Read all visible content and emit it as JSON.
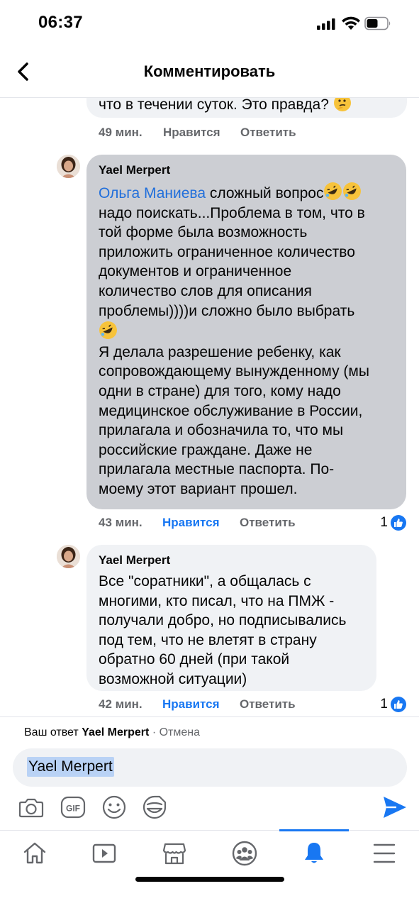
{
  "status_bar": {
    "time": "06:37"
  },
  "header": {
    "title": "Комментировать"
  },
  "previous_comment": {
    "text_tail": "что в течении суток. Это правда?",
    "time": "49 мин.",
    "like_label": "Нравится",
    "reply_label": "Ответить"
  },
  "comments": [
    {
      "author": "Yael Merpert",
      "mention": "Ольга Маниева",
      "lines": [
        "сложный вопрос",
        "надо поискать...Проблема в том, что в",
        "той форме была возможность",
        "приложить ограниченное количество",
        "документов и ограниченное",
        "количество слов для описания",
        "проблемы))))и сложно было выбрать",
        "Я делала разрешение ребенку, как",
        "сопровождающему вынужденному (мы",
        "одни в стране) для того, кому надо",
        "медицинское обслуживание в России,",
        "прилагала и обозначила то, что мы",
        "российские граждане. Даже не",
        "прилагала местные паспорта. По-",
        "моему этот вариант прошел."
      ],
      "time": "43 мин.",
      "like_label": "Нравится",
      "reply_label": "Ответить",
      "like_count": "1"
    },
    {
      "author": "Yael Merpert",
      "lines": [
        "Все \"соратники\", а общалась с",
        "многими, кто писал, что на ПМЖ -",
        "получали добро, но подписывались",
        "под тем, что не влетят в страну",
        "обратно 60 дней (при такой",
        "возможной ситуации)"
      ],
      "time": "42 мин.",
      "like_label": "Нравится",
      "reply_label": "Ответить",
      "like_count": "1"
    }
  ],
  "reply_bar": {
    "prefix": "Ваш ответ",
    "target": "Yael Merpert",
    "separator": "·",
    "cancel_label": "Отмена",
    "input_value": "Yael Merpert"
  },
  "colors": {
    "accent": "#1877f2",
    "bubble": "#f0f2f5",
    "bubble_selected": "#ccced3",
    "muted": "#65676b",
    "emoji": "#f7c33b"
  },
  "icons": [
    "back-chevron-icon",
    "camera-icon",
    "gif-icon",
    "emoji-icon",
    "sticker-icon",
    "send-icon",
    "home-icon",
    "video-icon",
    "marketplace-icon",
    "groups-icon",
    "notifications-icon",
    "menu-icon"
  ]
}
